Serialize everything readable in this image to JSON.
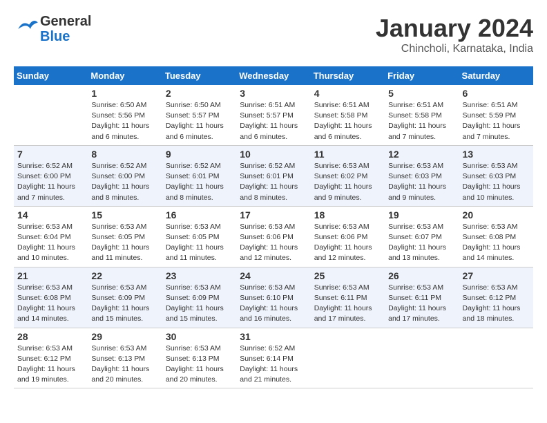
{
  "header": {
    "logo_line1": "General",
    "logo_line2": "Blue",
    "month": "January 2024",
    "location": "Chincholi, Karnataka, India"
  },
  "weekdays": [
    "Sunday",
    "Monday",
    "Tuesday",
    "Wednesday",
    "Thursday",
    "Friday",
    "Saturday"
  ],
  "weeks": [
    [
      {
        "day": "",
        "info": ""
      },
      {
        "day": "1",
        "info": "Sunrise: 6:50 AM\nSunset: 5:56 PM\nDaylight: 11 hours\nand 6 minutes."
      },
      {
        "day": "2",
        "info": "Sunrise: 6:50 AM\nSunset: 5:57 PM\nDaylight: 11 hours\nand 6 minutes."
      },
      {
        "day": "3",
        "info": "Sunrise: 6:51 AM\nSunset: 5:57 PM\nDaylight: 11 hours\nand 6 minutes."
      },
      {
        "day": "4",
        "info": "Sunrise: 6:51 AM\nSunset: 5:58 PM\nDaylight: 11 hours\nand 6 minutes."
      },
      {
        "day": "5",
        "info": "Sunrise: 6:51 AM\nSunset: 5:58 PM\nDaylight: 11 hours\nand 7 minutes."
      },
      {
        "day": "6",
        "info": "Sunrise: 6:51 AM\nSunset: 5:59 PM\nDaylight: 11 hours\nand 7 minutes."
      }
    ],
    [
      {
        "day": "7",
        "info": "Sunrise: 6:52 AM\nSunset: 6:00 PM\nDaylight: 11 hours\nand 7 minutes."
      },
      {
        "day": "8",
        "info": "Sunrise: 6:52 AM\nSunset: 6:00 PM\nDaylight: 11 hours\nand 8 minutes."
      },
      {
        "day": "9",
        "info": "Sunrise: 6:52 AM\nSunset: 6:01 PM\nDaylight: 11 hours\nand 8 minutes."
      },
      {
        "day": "10",
        "info": "Sunrise: 6:52 AM\nSunset: 6:01 PM\nDaylight: 11 hours\nand 8 minutes."
      },
      {
        "day": "11",
        "info": "Sunrise: 6:53 AM\nSunset: 6:02 PM\nDaylight: 11 hours\nand 9 minutes."
      },
      {
        "day": "12",
        "info": "Sunrise: 6:53 AM\nSunset: 6:03 PM\nDaylight: 11 hours\nand 9 minutes."
      },
      {
        "day": "13",
        "info": "Sunrise: 6:53 AM\nSunset: 6:03 PM\nDaylight: 11 hours\nand 10 minutes."
      }
    ],
    [
      {
        "day": "14",
        "info": "Sunrise: 6:53 AM\nSunset: 6:04 PM\nDaylight: 11 hours\nand 10 minutes."
      },
      {
        "day": "15",
        "info": "Sunrise: 6:53 AM\nSunset: 6:05 PM\nDaylight: 11 hours\nand 11 minutes."
      },
      {
        "day": "16",
        "info": "Sunrise: 6:53 AM\nSunset: 6:05 PM\nDaylight: 11 hours\nand 11 minutes."
      },
      {
        "day": "17",
        "info": "Sunrise: 6:53 AM\nSunset: 6:06 PM\nDaylight: 11 hours\nand 12 minutes."
      },
      {
        "day": "18",
        "info": "Sunrise: 6:53 AM\nSunset: 6:06 PM\nDaylight: 11 hours\nand 12 minutes."
      },
      {
        "day": "19",
        "info": "Sunrise: 6:53 AM\nSunset: 6:07 PM\nDaylight: 11 hours\nand 13 minutes."
      },
      {
        "day": "20",
        "info": "Sunrise: 6:53 AM\nSunset: 6:08 PM\nDaylight: 11 hours\nand 14 minutes."
      }
    ],
    [
      {
        "day": "21",
        "info": "Sunrise: 6:53 AM\nSunset: 6:08 PM\nDaylight: 11 hours\nand 14 minutes."
      },
      {
        "day": "22",
        "info": "Sunrise: 6:53 AM\nSunset: 6:09 PM\nDaylight: 11 hours\nand 15 minutes."
      },
      {
        "day": "23",
        "info": "Sunrise: 6:53 AM\nSunset: 6:09 PM\nDaylight: 11 hours\nand 15 minutes."
      },
      {
        "day": "24",
        "info": "Sunrise: 6:53 AM\nSunset: 6:10 PM\nDaylight: 11 hours\nand 16 minutes."
      },
      {
        "day": "25",
        "info": "Sunrise: 6:53 AM\nSunset: 6:11 PM\nDaylight: 11 hours\nand 17 minutes."
      },
      {
        "day": "26",
        "info": "Sunrise: 6:53 AM\nSunset: 6:11 PM\nDaylight: 11 hours\nand 17 minutes."
      },
      {
        "day": "27",
        "info": "Sunrise: 6:53 AM\nSunset: 6:12 PM\nDaylight: 11 hours\nand 18 minutes."
      }
    ],
    [
      {
        "day": "28",
        "info": "Sunrise: 6:53 AM\nSunset: 6:12 PM\nDaylight: 11 hours\nand 19 minutes."
      },
      {
        "day": "29",
        "info": "Sunrise: 6:53 AM\nSunset: 6:13 PM\nDaylight: 11 hours\nand 20 minutes."
      },
      {
        "day": "30",
        "info": "Sunrise: 6:53 AM\nSunset: 6:13 PM\nDaylight: 11 hours\nand 20 minutes."
      },
      {
        "day": "31",
        "info": "Sunrise: 6:52 AM\nSunset: 6:14 PM\nDaylight: 11 hours\nand 21 minutes."
      },
      {
        "day": "",
        "info": ""
      },
      {
        "day": "",
        "info": ""
      },
      {
        "day": "",
        "info": ""
      }
    ]
  ]
}
